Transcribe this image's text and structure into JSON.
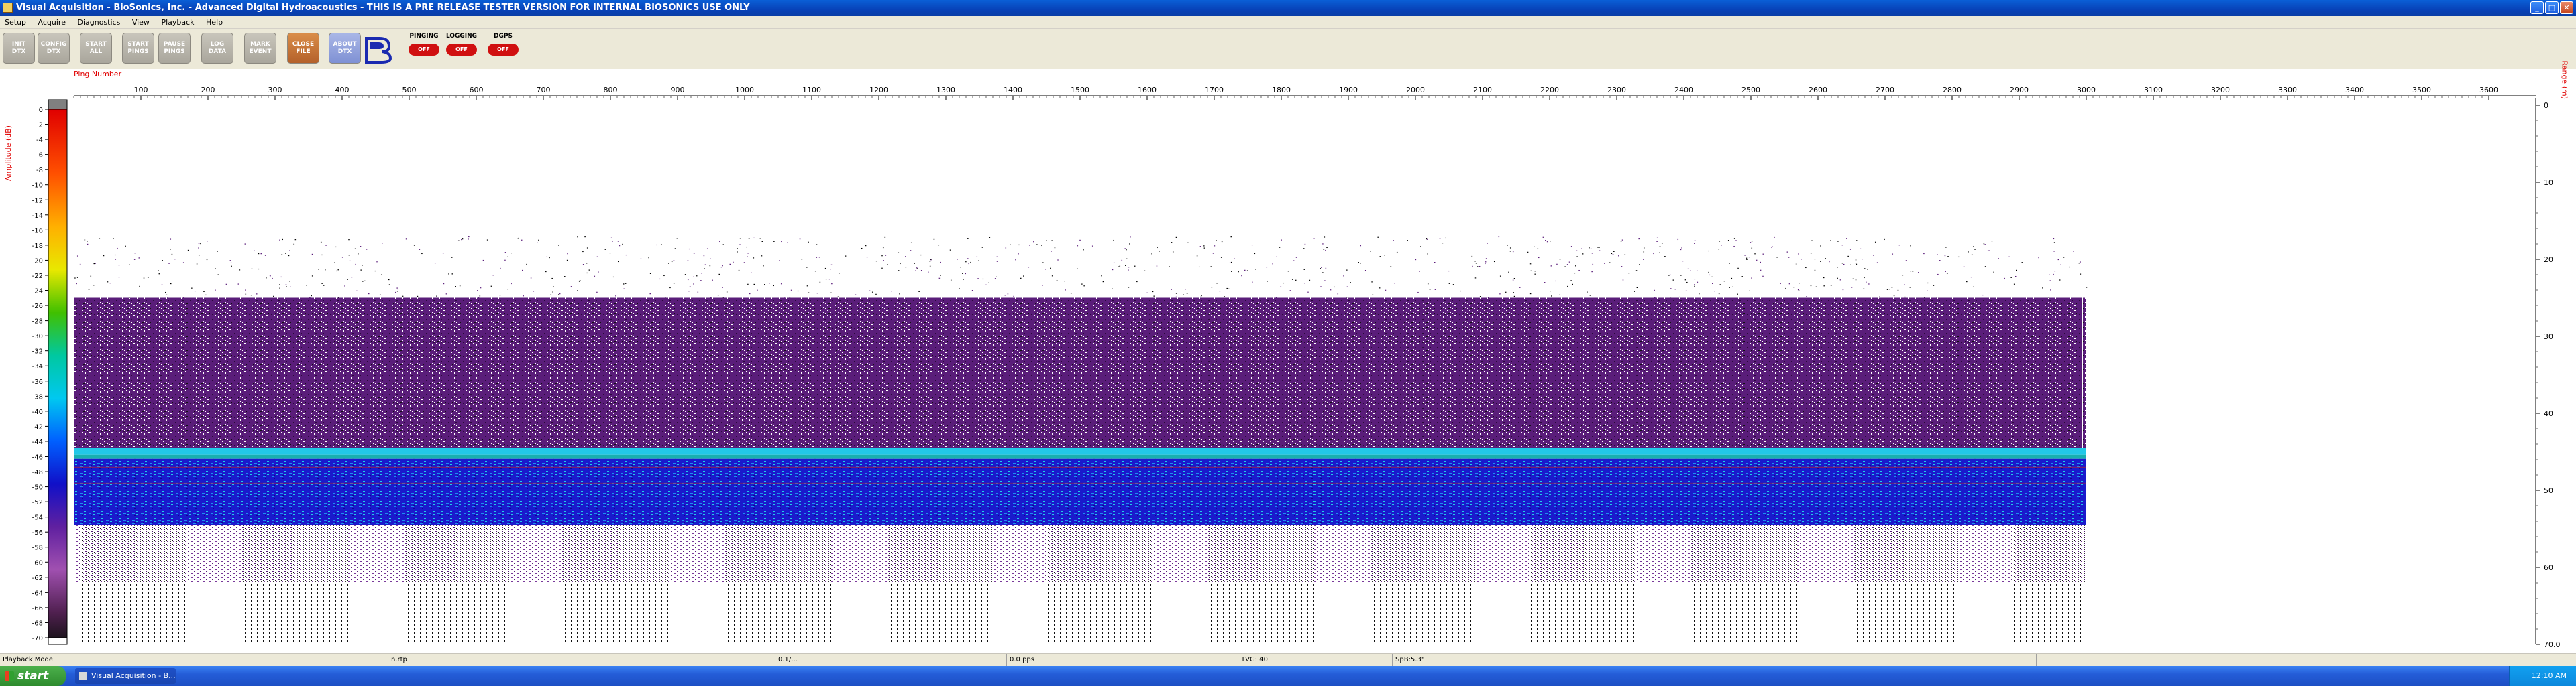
{
  "window": {
    "title": "Visual Acquisition  -  BioSonics, Inc.  -  Advanced Digital Hydroacoustics  -  THIS IS A PRE RELEASE TESTER VERSION FOR INTERNAL BIOSONICS USE ONLY"
  },
  "menu": [
    "Setup",
    "Acquire",
    "Diagnostics",
    "View",
    "Playback",
    "Help"
  ],
  "toolbar": {
    "buttons": [
      {
        "line1": "INIT",
        "line2": "DTX"
      },
      {
        "line1": "CONFIG",
        "line2": "DTX"
      },
      {
        "line1": "START",
        "line2": "ALL"
      },
      {
        "line1": "START",
        "line2": "PINGS"
      },
      {
        "line1": "PAUSE",
        "line2": "PINGS"
      },
      {
        "line1": "LOG",
        "line2": "DATA"
      },
      {
        "line1": "MARK",
        "line2": "EVENT"
      },
      {
        "line1": "CLOSE",
        "line2": "FILE"
      },
      {
        "line1": "ABOUT",
        "line2": "DTX"
      }
    ],
    "toggles": [
      {
        "label": "PINGING",
        "state": "OFF"
      },
      {
        "label": "LOGGING",
        "state": "OFF"
      },
      {
        "label": "DGPS",
        "state": "OFF"
      }
    ]
  },
  "colorbar": {
    "label": "Amplitude (dB)",
    "ticks": [
      "0",
      "-2",
      "-4",
      "-6",
      "-8",
      "-10",
      "-12",
      "-14",
      "-16",
      "-18",
      "-20",
      "-22",
      "-24",
      "-26",
      "-28",
      "-30",
      "-32",
      "-34",
      "-36",
      "-38",
      "-40",
      "-42",
      "-44",
      "-46",
      "-48",
      "-50",
      "-52",
      "-54",
      "-56",
      "-58",
      "-60",
      "-62",
      "-64",
      "-66",
      "-68",
      "-70"
    ]
  },
  "axes": {
    "ping_label": "Ping Number",
    "ping_ticks": [
      "100",
      "200",
      "300",
      "400",
      "500",
      "600",
      "700",
      "800",
      "900",
      "1000",
      "1100",
      "1200",
      "1300",
      "1400",
      "1500",
      "1600",
      "1700",
      "1800",
      "1900",
      "2000",
      "2100",
      "2200",
      "2300",
      "2400",
      "2500",
      "2600",
      "2700",
      "2800",
      "2900",
      "3000",
      "3100",
      "3200",
      "3300",
      "3400",
      "3500",
      "3600"
    ],
    "range_label": "Range (m)",
    "range_ticks": [
      "0",
      "10",
      "20",
      "30",
      "40",
      "50",
      "60",
      "70.0"
    ]
  },
  "echogram": {
    "last_ping": 3000,
    "surface_noise_top_m": 25,
    "bottom_line_m": 44.5,
    "bottom_band_end_m": 54.5,
    "colors": {
      "purple": "#5a1d7a",
      "deep_blue": "#1a1acc",
      "cyan": "#22c8e8",
      "teal": "#18b0b0",
      "red": "#c82020"
    }
  },
  "status": {
    "mode": "Playback Mode",
    "field2": "In.rtp",
    "field3": "0.1/...",
    "field4": "0.0 pps",
    "field5": "TVG: 40",
    "field6": "SpB:5.3\""
  },
  "taskbar": {
    "start": "start",
    "task": "Visual Acquisition - B...",
    "clock": "12:10 AM"
  }
}
